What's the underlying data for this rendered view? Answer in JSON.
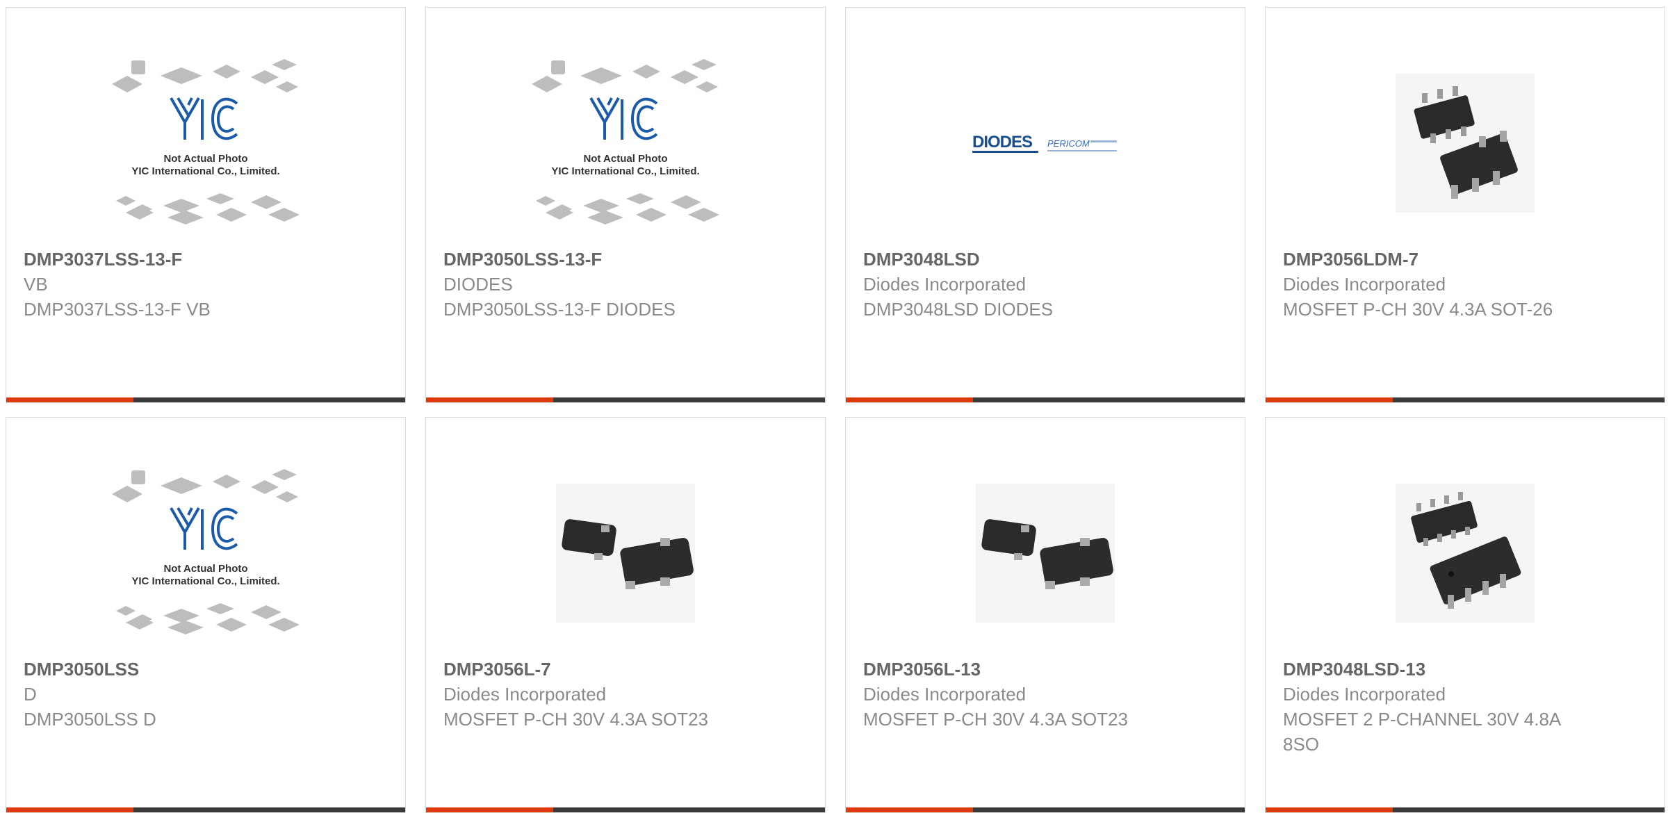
{
  "products": [
    {
      "part_number": "DMP3037LSS-13-F",
      "manufacturer": "VB",
      "description": "DMP3037LSS-13-F VB",
      "image": "yic-placeholder",
      "image_caption": "Not Actual Photo\nYIC International Co., Limited."
    },
    {
      "part_number": "DMP3050LSS-13-F",
      "manufacturer": "DIODES",
      "description": "DMP3050LSS-13-F DIODES",
      "image": "yic-placeholder",
      "image_caption": "Not Actual Photo\nYIC International Co., Limited."
    },
    {
      "part_number": "DMP3048LSD",
      "manufacturer": "Diodes Incorporated",
      "description": "DMP3048LSD DIODES",
      "image": "diodes-logo",
      "logo_text": "DIODES",
      "logo_text2": "PERICOM"
    },
    {
      "part_number": "DMP3056LDM-7",
      "manufacturer": "Diodes Incorporated",
      "description": "MOSFET P-CH 30V 4.3A SOT-26",
      "image": "sot26-package"
    },
    {
      "part_number": "DMP3050LSS",
      "manufacturer": "D",
      "description": "DMP3050LSS D",
      "image": "yic-placeholder",
      "image_caption": "Not Actual Photo\nYIC International Co., Limited."
    },
    {
      "part_number": "DMP3056L-7",
      "manufacturer": "Diodes Incorporated",
      "description": "MOSFET P-CH 30V 4.3A SOT23",
      "image": "sot23-package"
    },
    {
      "part_number": "DMP3056L-13",
      "manufacturer": "Diodes Incorporated",
      "description": "MOSFET P-CH 30V 4.3A SOT23",
      "image": "sot23-package"
    },
    {
      "part_number": "DMP3048LSD-13",
      "manufacturer": "Diodes Incorporated",
      "description": "MOSFET 2 P-CHANNEL 30V 4.8A 8SO",
      "image": "so8-package"
    }
  ],
  "colors": {
    "accent": "#e03a0c",
    "bar": "#3a3a3a",
    "yic_blue": "#1a5aa8"
  }
}
